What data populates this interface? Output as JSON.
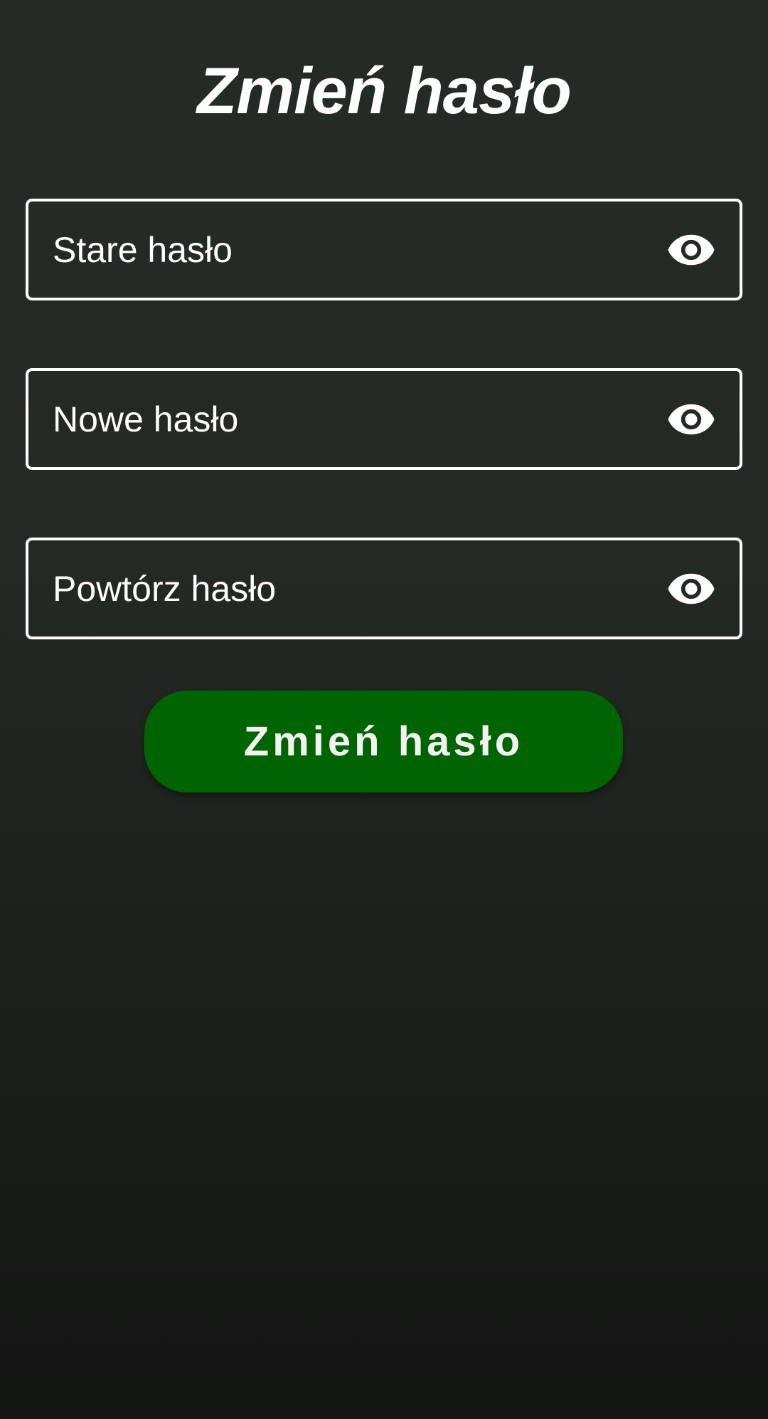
{
  "header": {
    "title": "Zmień hasło"
  },
  "form": {
    "fields": [
      {
        "label": "Stare hasło",
        "value": "",
        "icon": "eye-icon"
      },
      {
        "label": "Nowe hasło",
        "value": "",
        "icon": "eye-icon"
      },
      {
        "label": "Powtórz hasło",
        "value": "",
        "icon": "eye-icon"
      }
    ],
    "submit_label": "Zmień hasło"
  },
  "colors": {
    "background_top": "#252a26",
    "background_bottom": "#141514",
    "field_border": "#ffffff",
    "button_bg": "#006400",
    "text": "#ffffff"
  }
}
